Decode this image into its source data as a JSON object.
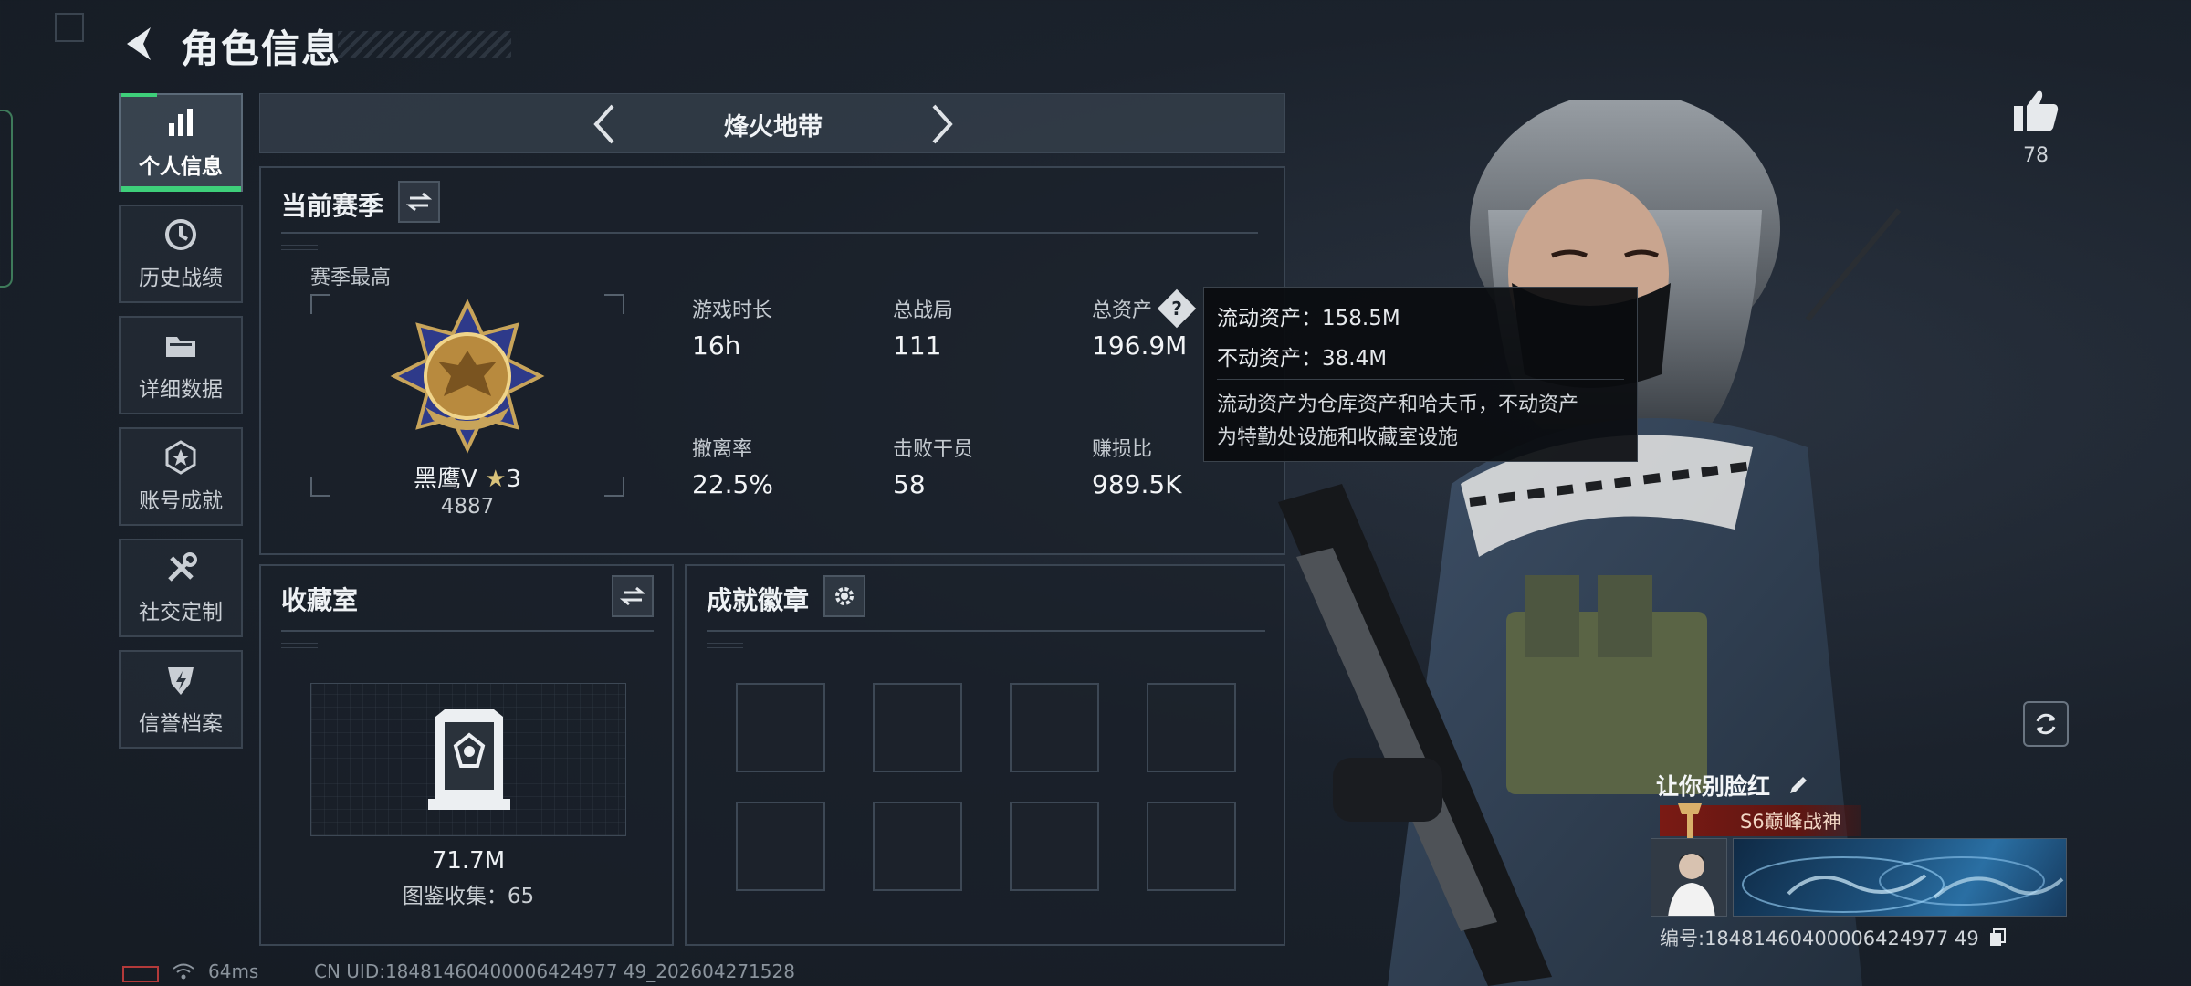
{
  "header": {
    "title": "角色信息"
  },
  "sidebar": {
    "items": [
      {
        "label": "个人信息",
        "icon": "bar-chart-icon",
        "active": true
      },
      {
        "label": "历史战绩",
        "icon": "history-icon",
        "active": false
      },
      {
        "label": "详细数据",
        "icon": "folder-icon",
        "active": false
      },
      {
        "label": "账号成就",
        "icon": "achievement-icon",
        "active": false
      },
      {
        "label": "社交定制",
        "icon": "tools-icon",
        "active": false
      },
      {
        "label": "信誉档案",
        "icon": "credit-shield-icon",
        "active": false
      }
    ]
  },
  "mode": {
    "name": "烽火地带"
  },
  "season": {
    "title": "当前赛季",
    "best_label": "赛季最高",
    "rank_name": "黑鹰Ⅴ",
    "rank_stars": "3",
    "rank_score": "4887",
    "stats": [
      {
        "label": "游戏时长",
        "value": "16h"
      },
      {
        "label": "总战局",
        "value": "111"
      },
      {
        "label": "总资产",
        "value": "196.9M"
      },
      {
        "label": "撤离率",
        "value": "22.5%"
      },
      {
        "label": "击败干员",
        "value": "58"
      },
      {
        "label": "赚损比",
        "value": "989.5K"
      }
    ]
  },
  "tooltip": {
    "liquid": "流动资产：158.5M",
    "fixed": "不动资产：38.4M",
    "desc_line1": "流动资产为仓库资产和哈夫币，不动资产",
    "desc_line2": "为特勤处设施和收藏室设施"
  },
  "collection": {
    "title": "收藏室",
    "value": "71.7M",
    "catalog": "图鉴收集：65"
  },
  "badges": {
    "title": "成就徽章",
    "slots": 8
  },
  "profile": {
    "likes": "78",
    "nickname": "让你别脸红",
    "honor_title": "S6巅峰战神",
    "uid_label": "编号:18481460400006424977 49"
  },
  "footer": {
    "ping": "64ms",
    "uid": "CN UID:18481460400006424977 49_202604271528"
  },
  "colors": {
    "accent": "#3ecf7a",
    "title_red": "#7a1a14",
    "panel_border": "#3a4552"
  }
}
